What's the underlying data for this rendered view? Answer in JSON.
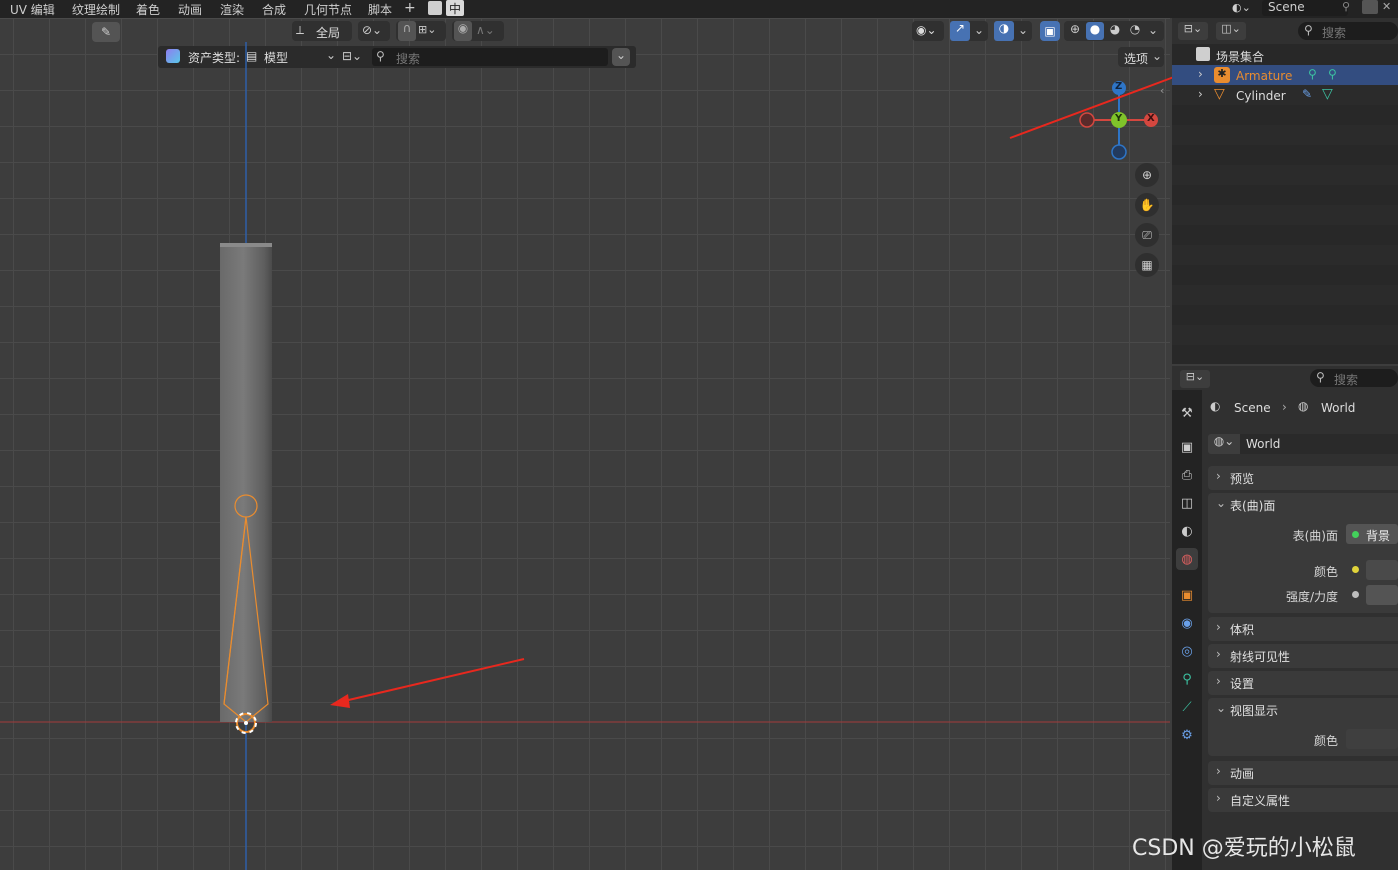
{
  "menu": {
    "items": [
      "UV 编辑",
      "纹理绘制",
      "着色",
      "动画",
      "渲染",
      "合成",
      "几何节点",
      "脚本"
    ],
    "add_label": "+",
    "ime_label": "中",
    "scene_label": "Scene"
  },
  "viewport_header": {
    "transform_orientation": "全局",
    "options_label": "选项"
  },
  "asset_bar": {
    "asset_type_label": "资产类型:",
    "asset_type_value": "模型",
    "search_placeholder": "搜索"
  },
  "gizmo": {
    "z": "Z",
    "y": "Y",
    "x": "X"
  },
  "outliner": {
    "search_placeholder": "搜索",
    "collection_label": "场景集合",
    "items": [
      {
        "label": "Armature",
        "selected": true
      },
      {
        "label": "Cylinder",
        "selected": false
      }
    ]
  },
  "properties": {
    "search_placeholder": "搜索",
    "breadcrumb": [
      "Scene",
      "World"
    ],
    "world_name": "World",
    "panels": {
      "preview": "预览",
      "surface": "表(曲)面",
      "surface_label": "表(曲)面",
      "surface_value": "背景",
      "color_label": "颜色",
      "strength_label": "强度/力度",
      "volume": "体积",
      "ray_visibility": "射线可见性",
      "settings": "设置",
      "viewport_display": "视图显示",
      "vd_color_label": "颜色",
      "animation": "动画",
      "custom_props": "自定义属性"
    }
  },
  "watermark": "CSDN @爱玩的小松鼠",
  "colors": {
    "accent_selected": "#334d80",
    "armature_orange": "#e98c2f",
    "axis_x": "#d4473f",
    "axis_y": "#7fc32a",
    "axis_z": "#2e75c7",
    "annotation_red": "#e8281e"
  }
}
